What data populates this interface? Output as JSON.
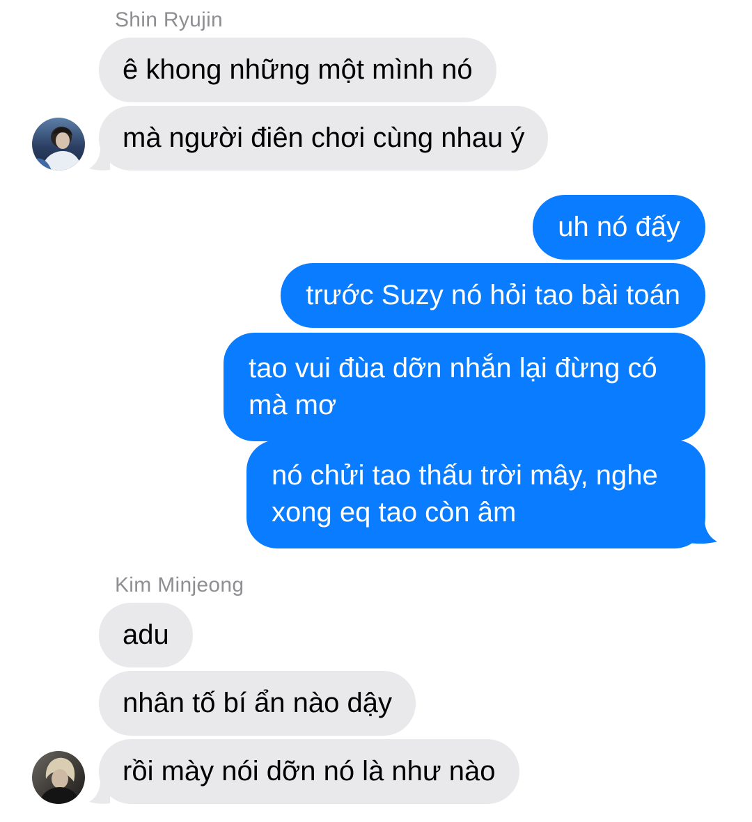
{
  "conversation": {
    "groups": [
      {
        "sender": "Shin Ryujin",
        "avatar_icon": "profile-photo-avatar",
        "messages": [
          "ê khong những một mình nó",
          "mà người điên chơi cùng nhau ý"
        ]
      },
      {
        "sender": "me",
        "messages": [
          "uh nó đấy",
          "trước Suzy nó hỏi tao bài toán",
          "tao vui đùa dỡn nhắn lại đừng có mà mơ",
          "nó chửi tao thấu trời mây, nghe xong eq tao còn âm"
        ]
      },
      {
        "sender": "Kim Minjeong",
        "avatar_icon": "profile-photo-avatar",
        "messages": [
          "adu",
          "nhân tố bí ẩn nào dậy",
          "rồi mày nói dỡn nó là như nào"
        ]
      }
    ]
  },
  "colors": {
    "incoming_bubble": "#e9e9eb",
    "outgoing_bubble": "#0a7cff",
    "sender_name": "#8e8e93"
  }
}
